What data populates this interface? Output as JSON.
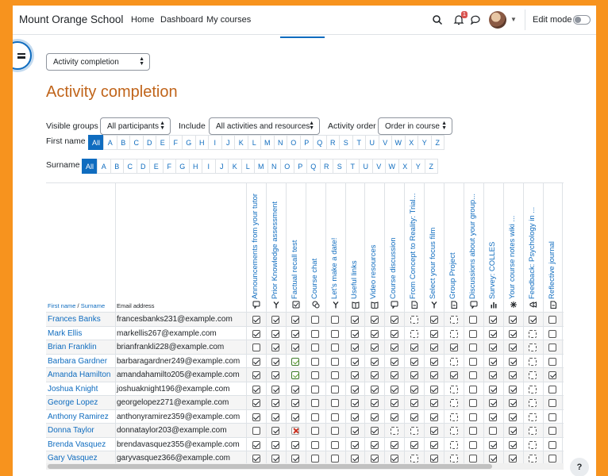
{
  "app": {
    "brand": "Mount Orange School",
    "nav": [
      "Home",
      "Dashboard",
      "My courses"
    ],
    "notification_count": "1",
    "edit_mode_label": "Edit mode"
  },
  "report_selector": "Activity completion",
  "page_title": "Activity completion",
  "filters": {
    "visible_groups_label": "Visible groups",
    "visible_groups_value": "All participants",
    "include_label": "Include",
    "include_value": "All activities and resources",
    "activity_order_label": "Activity order",
    "activity_order_value": "Order in course"
  },
  "initials": {
    "first_name_label": "First name",
    "surname_label": "Surname",
    "letters": [
      "All",
      "A",
      "B",
      "C",
      "D",
      "E",
      "F",
      "G",
      "H",
      "I",
      "J",
      "K",
      "L",
      "M",
      "N",
      "O",
      "P",
      "Q",
      "R",
      "S",
      "T",
      "U",
      "V",
      "W",
      "X",
      "Y",
      "Z"
    ]
  },
  "table": {
    "header_first": "First name",
    "header_slash": " / ",
    "header_surname": "Surname",
    "header_email": "Email address",
    "activities": [
      {
        "name": "Announcements from your tutor",
        "icon": "forum-icon"
      },
      {
        "name": "Prior Knowledge assessment",
        "icon": "choice-icon"
      },
      {
        "name": "Factual recall test",
        "icon": "quiz-icon"
      },
      {
        "name": "Course chat",
        "icon": "chat-icon"
      },
      {
        "name": "Let's make a date!",
        "icon": "choice-icon"
      },
      {
        "name": "Useful links",
        "icon": "book-icon"
      },
      {
        "name": "Video resources",
        "icon": "book-icon"
      },
      {
        "name": "Course discussion",
        "icon": "forum-icon"
      },
      {
        "name": "From Concept to Reality: Trial...",
        "icon": "assign-icon"
      },
      {
        "name": "Select your focus film",
        "icon": "choice-icon"
      },
      {
        "name": "Group Project",
        "icon": "assign-icon"
      },
      {
        "name": "Discussions about your group...",
        "icon": "forum-icon"
      },
      {
        "name": "Survey: COLLES",
        "icon": "survey-icon"
      },
      {
        "name": "Your course notes wiki ...",
        "icon": "wiki-icon"
      },
      {
        "name": "Feedback: Psychology in ...",
        "icon": "feedback-icon"
      },
      {
        "name": "Reflective journal",
        "icon": "assign-icon"
      }
    ],
    "rows": [
      {
        "name": "Frances Banks",
        "email": "francesbanks231@example.com",
        "status": [
          "d",
          "d",
          "d",
          "e",
          "e",
          "d",
          "d",
          "d",
          "n",
          "d",
          "n",
          "e",
          "d",
          "d",
          "d",
          "e"
        ]
      },
      {
        "name": "Mark Ellis",
        "email": "markellis267@example.com",
        "status": [
          "d",
          "d",
          "d",
          "e",
          "e",
          "d",
          "d",
          "d",
          "n",
          "d",
          "n",
          "e",
          "d",
          "d",
          "n",
          "e"
        ]
      },
      {
        "name": "Brian Franklin",
        "email": "brianfrankli228@example.com",
        "status": [
          "e",
          "d",
          "d",
          "e",
          "e",
          "d",
          "d",
          "d",
          "d",
          "d",
          "d",
          "e",
          "d",
          "d",
          "n",
          "e"
        ]
      },
      {
        "name": "Barbara Gardner",
        "email": "barbaragardner249@example.com",
        "status": [
          "d",
          "d",
          "p",
          "e",
          "e",
          "d",
          "d",
          "d",
          "d",
          "d",
          "n",
          "e",
          "d",
          "d",
          "n",
          "e"
        ]
      },
      {
        "name": "Amanda Hamilton",
        "email": "amandahamilto205@example.com",
        "status": [
          "d",
          "d",
          "p",
          "e",
          "e",
          "d",
          "d",
          "d",
          "d",
          "d",
          "d",
          "e",
          "d",
          "d",
          "n",
          "d"
        ]
      },
      {
        "name": "Joshua Knight",
        "email": "joshuaknight196@example.com",
        "status": [
          "d",
          "d",
          "d",
          "e",
          "e",
          "d",
          "d",
          "d",
          "d",
          "d",
          "n",
          "e",
          "d",
          "d",
          "n",
          "e"
        ]
      },
      {
        "name": "George Lopez",
        "email": "georgelopez271@example.com",
        "status": [
          "d",
          "d",
          "d",
          "e",
          "e",
          "d",
          "d",
          "d",
          "d",
          "d",
          "n",
          "e",
          "d",
          "d",
          "n",
          "e"
        ]
      },
      {
        "name": "Anthony Ramirez",
        "email": "anthonyramirez359@example.com",
        "status": [
          "d",
          "d",
          "d",
          "e",
          "e",
          "d",
          "d",
          "d",
          "d",
          "d",
          "n",
          "e",
          "d",
          "d",
          "n",
          "e"
        ]
      },
      {
        "name": "Donna Taylor",
        "email": "donnataylor203@example.com",
        "status": [
          "e",
          "d",
          "f",
          "e",
          "e",
          "d",
          "d",
          "n",
          "n",
          "d",
          "n",
          "e",
          "e",
          "d",
          "n",
          "e"
        ]
      },
      {
        "name": "Brenda Vasquez",
        "email": "brendavasquez355@example.com",
        "status": [
          "d",
          "d",
          "d",
          "e",
          "e",
          "d",
          "d",
          "d",
          "d",
          "d",
          "n",
          "e",
          "d",
          "d",
          "n",
          "e"
        ]
      },
      {
        "name": "Gary Vasquez",
        "email": "garyvasquez366@example.com",
        "status": [
          "d",
          "d",
          "d",
          "e",
          "e",
          "d",
          "d",
          "d",
          "n",
          "d",
          "n",
          "e",
          "d",
          "d",
          "n",
          "e"
        ]
      }
    ]
  },
  "help_label": "?",
  "colors": {
    "accent": "#0f6cbf",
    "title": "#c0641a",
    "frame": "#f7931e"
  }
}
